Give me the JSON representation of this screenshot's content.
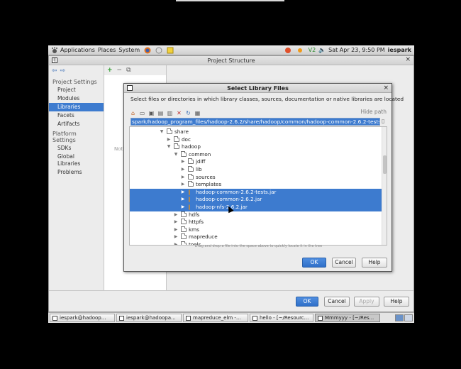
{
  "panel": {
    "menus": [
      "Applications",
      "Places",
      "System"
    ],
    "datetime": "Sat Apr 23,  9:50 PM",
    "user": "iespark",
    "status_icons": [
      "network-icon",
      "volume-icon"
    ]
  },
  "ide": {
    "title": "Project Structure",
    "nav": {
      "sections": [
        {
          "title": "Project Settings",
          "items": [
            "Project",
            "Modules",
            "Libraries",
            "Facets",
            "Artifacts"
          ]
        },
        {
          "title": "Platform Settings",
          "items": [
            "SDKs",
            "Global Libraries"
          ]
        }
      ],
      "problems": "Problems",
      "selected": "Libraries"
    },
    "nothing_label": "Noth",
    "buttons": {
      "ok": "OK",
      "cancel": "Cancel",
      "apply": "Apply",
      "help": "Help"
    }
  },
  "dialog": {
    "title": "Select Library Files",
    "description": "Select files or directories in which library classes, sources, documentation or native libraries are located",
    "hide_path": "Hide path",
    "path": "spark/hadoop_program_files/hadoop-2.6.2/share/hadoop/common/hadoop-common-2.6.2-tests.jar",
    "tree": [
      {
        "label": "share",
        "level": 0,
        "type": "folder",
        "expanded": true,
        "selected": false
      },
      {
        "label": "doc",
        "level": 1,
        "type": "folder",
        "expanded": false,
        "selected": false
      },
      {
        "label": "hadoop",
        "level": 1,
        "type": "folder",
        "expanded": true,
        "selected": false
      },
      {
        "label": "common",
        "level": 2,
        "type": "folder",
        "expanded": true,
        "selected": false
      },
      {
        "label": "jdiff",
        "level": 3,
        "type": "folder",
        "expanded": false,
        "selected": false
      },
      {
        "label": "lib",
        "level": 3,
        "type": "folder",
        "expanded": false,
        "selected": false
      },
      {
        "label": "sources",
        "level": 3,
        "type": "folder",
        "expanded": false,
        "selected": false
      },
      {
        "label": "templates",
        "level": 3,
        "type": "folder",
        "expanded": false,
        "selected": false
      },
      {
        "label": "hadoop-common-2.6.2-tests.jar",
        "level": 3,
        "type": "jar",
        "expanded": false,
        "selected": true
      },
      {
        "label": "hadoop-common-2.6.2.jar",
        "level": 3,
        "type": "jar",
        "expanded": false,
        "selected": true
      },
      {
        "label": "hadoop-nfs-2.6.2.jar",
        "level": 3,
        "type": "jar",
        "expanded": false,
        "selected": true
      },
      {
        "label": "hdfs",
        "level": 2,
        "type": "folder",
        "expanded": false,
        "selected": false
      },
      {
        "label": "httpfs",
        "level": 2,
        "type": "folder",
        "expanded": false,
        "selected": false
      },
      {
        "label": "kms",
        "level": 2,
        "type": "folder",
        "expanded": false,
        "selected": false
      },
      {
        "label": "mapreduce",
        "level": 2,
        "type": "folder",
        "expanded": false,
        "selected": false
      },
      {
        "label": "tools",
        "level": 2,
        "type": "folder",
        "expanded": false,
        "selected": false
      }
    ],
    "drag_hint": "Drag and drop a file into the space above to quickly locate it in the tree",
    "buttons": {
      "ok": "OK",
      "cancel": "Cancel",
      "help": "Help"
    }
  },
  "taskbar": {
    "tasks": [
      "iespark@hadoop...",
      "iespark@hadoopa...",
      "mapreduce_elm -...",
      "hello - [~/Resourc...",
      "Mmmyyy - [~/Res..."
    ],
    "active_index": 4
  },
  "colors": {
    "selection": "#3d7bcf",
    "primary_button": "#2f6fc8"
  }
}
